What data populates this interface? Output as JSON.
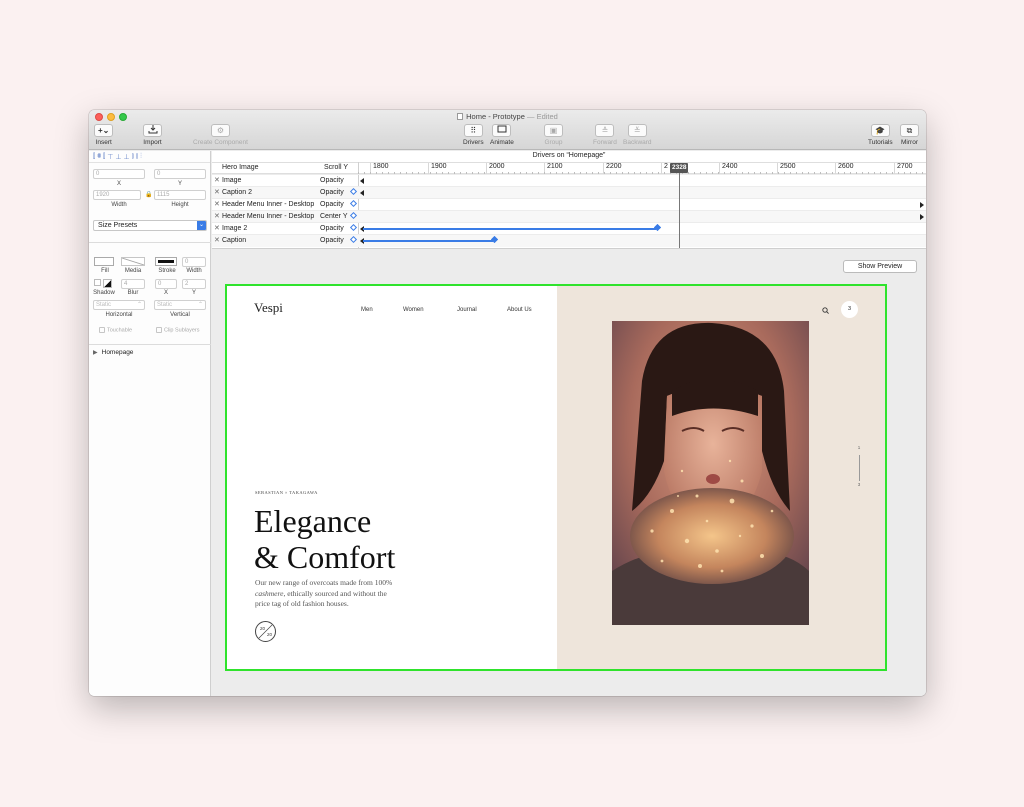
{
  "window": {
    "title": "Home - Prototype",
    "title_status": "— Edited"
  },
  "toolbar": {
    "insert_icon": "+⌄",
    "insert": "Insert",
    "import": "Import",
    "create_component": "Create Component",
    "drivers": "Drivers",
    "animate": "Animate",
    "group": "Group",
    "forward": "Forward",
    "backward": "Backward",
    "tutorials": "Tutorials",
    "mirror": "Mirror"
  },
  "inspector": {
    "x_value": "0",
    "y_value": "0",
    "x_label": "X",
    "y_label": "Y",
    "width_value": "1920",
    "height_value": "1115",
    "width_label": "Width",
    "height_label": "Height",
    "size_presets": "Size Presets",
    "fill_label": "Fill",
    "media_label": "Media",
    "stroke_label": "Stroke",
    "stroke_width_value": "0",
    "stroke_width_label": "Width",
    "shadow_label": "Shadow",
    "blur_value": "4",
    "blur_label": "Blur",
    "shadow_x_value": "0",
    "shadow_y_value": "2",
    "shadow_x_label": "X",
    "shadow_y_label": "Y",
    "horizontal_value": "Static",
    "vertical_value": "Static",
    "horizontal_label": "Horizontal",
    "vertical_label": "Vertical",
    "touchable_label": "Touchable",
    "clip_sublayers_label": "Clip Sublayers",
    "layer_name": "Homepage"
  },
  "timeline": {
    "title": "Drivers on “Homepage”",
    "driver_name": "Hero Image",
    "driver_property": "Scroll Y",
    "ticks": [
      "1800",
      "1900",
      "2000",
      "2100",
      "2200",
      "2",
      "2400",
      "2500",
      "2600",
      "2700"
    ],
    "playhead_value": "2328",
    "rows": [
      {
        "name": "Image",
        "property": "Opacity"
      },
      {
        "name": "Caption 2",
        "property": "Opacity"
      },
      {
        "name": "Header Menu Inner - Desktop",
        "property": "Opacity"
      },
      {
        "name": "Header Menu Inner - Desktop",
        "property": "Center Y"
      },
      {
        "name": "Image 2",
        "property": "Opacity"
      },
      {
        "name": "Caption",
        "property": "Opacity"
      }
    ]
  },
  "canvas": {
    "show_preview": "Show Preview"
  },
  "site": {
    "logo": "Vespi",
    "nav": [
      "Men",
      "Women",
      "Journal",
      "About Us"
    ],
    "bag_count": "3",
    "eyebrow": "SEBASTIAN  ×  TAKAGAWA",
    "headline_1": "Elegance",
    "headline_2": "& Comfort",
    "body_1": "Our new range of overcoats made from 100%",
    "body_2a": "cashmere",
    "body_2b": ", ethically sourced and without the",
    "body_3": "price tag of old fashion houses.",
    "badge_top": "20",
    "badge_bottom": "20",
    "pager_top": "1",
    "pager_bottom": "3"
  },
  "colors": {
    "accent": "#3a7ce6",
    "selection": "#2fe32c",
    "hero_bg": "#eee5db",
    "page_bg": "#fbf1f1"
  }
}
